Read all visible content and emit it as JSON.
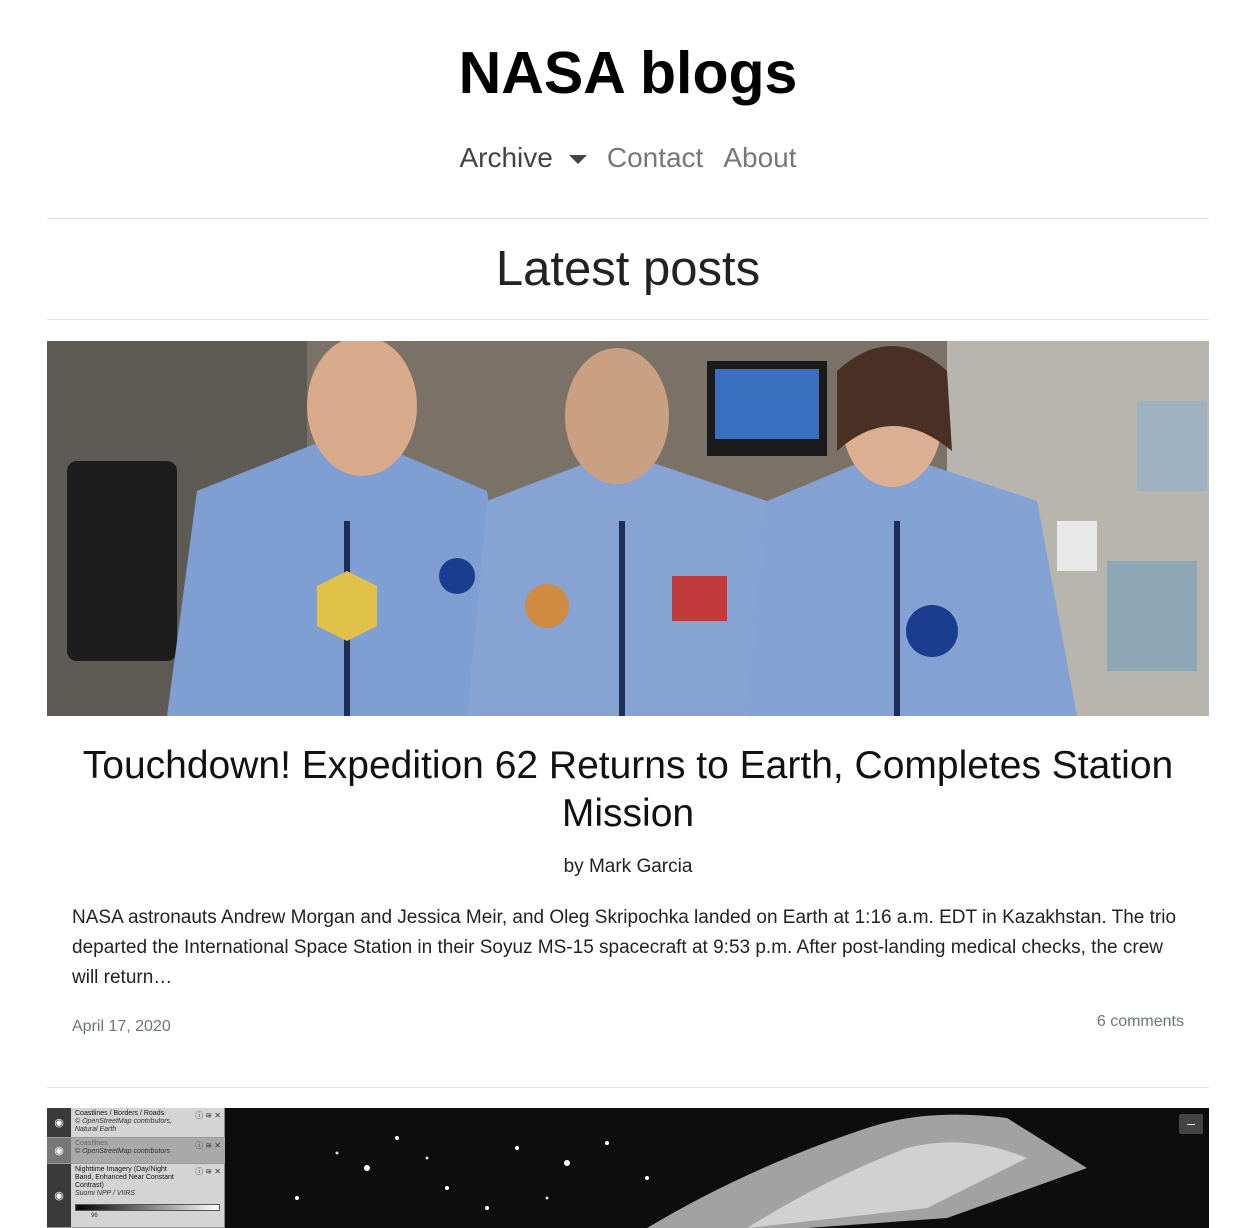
{
  "site": {
    "title": "NASA blogs"
  },
  "nav": {
    "archive_label": "Archive",
    "contact_label": "Contact",
    "about_label": "About"
  },
  "section": {
    "title": "Latest posts"
  },
  "post": {
    "title": "Touchdown! Expedition 62 Returns to Earth, Completes Station Mission",
    "byline": "by Mark Garcia",
    "excerpt": "NASA astronauts Andrew Morgan and Jessica Meir, and Oleg Skripochka landed on Earth at 1:16 a.m. EDT in Kazakhstan. The trio departed the International Space Station in their Soyuz MS-15 spacecraft at 9:53 p.m. After post-landing medical checks, the crew will return…",
    "date": "April 17, 2020",
    "comments": "6 comments"
  },
  "map_preview": {
    "layers": [
      {
        "name": "Coastlines / Borders / Roads",
        "credit1": "© OpenStreetMap contributors,",
        "credit2": "Natural Earth"
      },
      {
        "name": "Coastlines",
        "credit1": "© OpenStreetMap contributors",
        "credit2": ""
      },
      {
        "name": "Nighttime Imagery (Day/Night Band, Enhanced Near Constant Contrast)",
        "credit1": "Suomi NPP / VIIRS",
        "credit2": ""
      }
    ],
    "colorbar_value": "96",
    "collapse_label": "–"
  },
  "colors": {
    "nav_active": "#444444",
    "nav_link": "#777777",
    "muted": "#6c757d",
    "divider": "#e2e2e2"
  }
}
